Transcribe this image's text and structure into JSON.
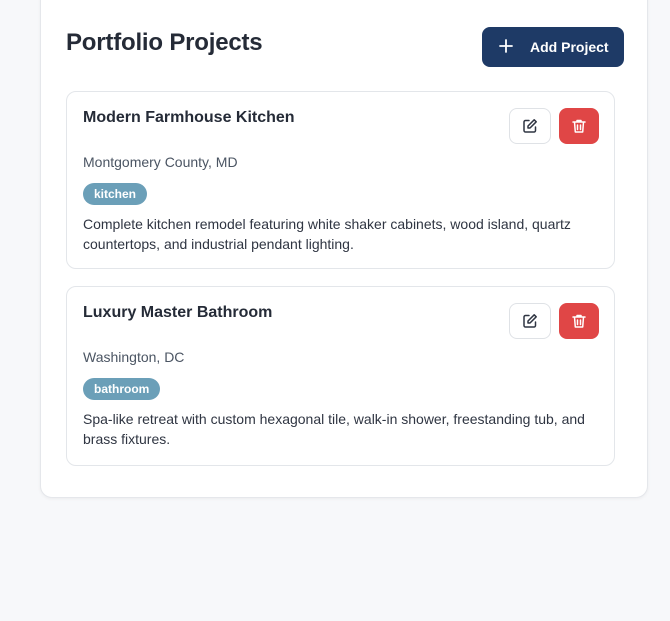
{
  "header": {
    "title": "Portfolio Projects",
    "add_button_label": "Add Project",
    "add_button_icon": "plus-icon"
  },
  "colors": {
    "primary": "#1e3a66",
    "danger": "#e04646",
    "tag": "#6b9fb8"
  },
  "projects": [
    {
      "title": "Modern Farmhouse Kitchen",
      "location": "Montgomery County, MD",
      "tag": "kitchen",
      "description": "Complete kitchen remodel featuring white shaker cabinets, wood island, quartz countertops, and industrial pendant lighting.",
      "edit_icon": "edit-icon",
      "delete_icon": "trash-icon"
    },
    {
      "title": "Luxury Master Bathroom",
      "location": "Washington, DC",
      "tag": "bathroom",
      "description": "Spa-like retreat with custom hexagonal tile, walk-in shower, freestanding tub, and brass fixtures.",
      "edit_icon": "edit-icon",
      "delete_icon": "trash-icon"
    }
  ]
}
